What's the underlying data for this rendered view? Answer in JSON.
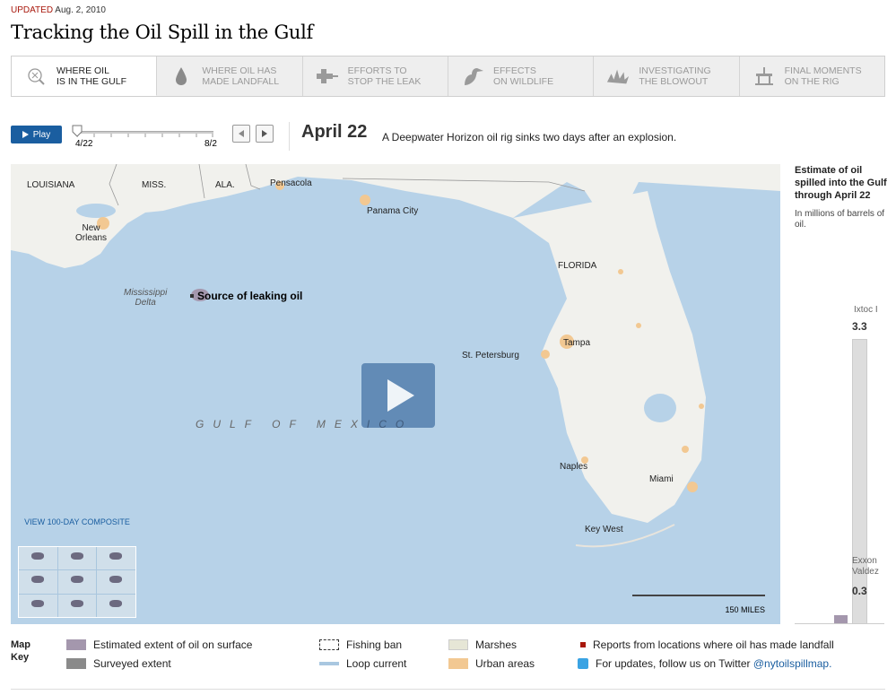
{
  "header": {
    "updated_label": "UPDATED",
    "updated_date": "Aug. 2, 2010",
    "title": "Tracking the Oil Spill in the Gulf"
  },
  "tabs": [
    {
      "label": "WHERE OIL\nIS IN THE GULF",
      "icon": "magnifier-icon",
      "active": true
    },
    {
      "label": "WHERE OIL HAS\nMADE LANDFALL",
      "icon": "oil-drop-icon",
      "active": false
    },
    {
      "label": "EFFORTS TO\nSTOP THE LEAK",
      "icon": "pipe-valve-icon",
      "active": false
    },
    {
      "label": "EFFECTS\nON WILDLIFE",
      "icon": "pelican-icon",
      "active": false
    },
    {
      "label": "INVESTIGATING\nTHE BLOWOUT",
      "icon": "explosion-icon",
      "active": false
    },
    {
      "label": "FINAL MOMENTS\nON THE RIG",
      "icon": "oil-rig-icon",
      "active": false
    }
  ],
  "controls": {
    "play_label": "Play",
    "slider_start": "4/22",
    "slider_end": "8/2",
    "slider_position": 0,
    "current_date": "April 22",
    "caption": "A Deepwater Horizon oil rig sinks two days after an explosion."
  },
  "map": {
    "labels": {
      "louisiana": "LOUISIANA",
      "miss": "MISS.",
      "ala": "ALA.",
      "pensacola": "Pensacola",
      "panama_city": "Panama City",
      "new_orleans": "New\nOrleans",
      "mississippi_delta": "Mississippi\nDelta",
      "florida": "FLORIDA",
      "tampa": "Tampa",
      "st_petersburg": "St. Petersburg",
      "naples": "Naples",
      "miami": "Miami",
      "key_west": "Key West",
      "gulf": "GULF OF MEXICO",
      "source": "Source of leaking oil"
    },
    "composite_label": "VIEW 100-DAY COMPOSITE",
    "scale_label": "150 MILES",
    "colors": {
      "water": "#b7d2e8",
      "land": "#f1f1ed",
      "urban": "#f2c892",
      "oil": "#a497ad"
    }
  },
  "sidebar": {
    "title": "Estimate of oil spilled into the Gulf through April 22",
    "unit": "In millions of barrels of oil.",
    "current_value": 0.1,
    "comparisons": [
      {
        "name": "Ixtoc I",
        "value": 3.3
      },
      {
        "name": "Exxon Valdez",
        "value": 0.3
      }
    ]
  },
  "key": {
    "title": "Map\nKey",
    "items": [
      {
        "label": "Estimated extent of oil on surface",
        "swatch": "#a497ad"
      },
      {
        "label": "Surveyed extent",
        "swatch": "#8a8a8a"
      },
      {
        "label": "Fishing ban",
        "swatch": "dashed"
      },
      {
        "label": "Loop current",
        "swatch": "#a9c7e0"
      },
      {
        "label": "Marshes",
        "swatch": "#e6e6d6"
      },
      {
        "label": "Urban areas",
        "swatch": "#f2c892"
      },
      {
        "label": "Reports from locations where oil has made landfall",
        "swatch": "#a8170b"
      },
      {
        "label": "For updates, follow us on Twitter ",
        "swatch": "twitter"
      }
    ],
    "twitter_handle": "@nytoilspillmap."
  }
}
